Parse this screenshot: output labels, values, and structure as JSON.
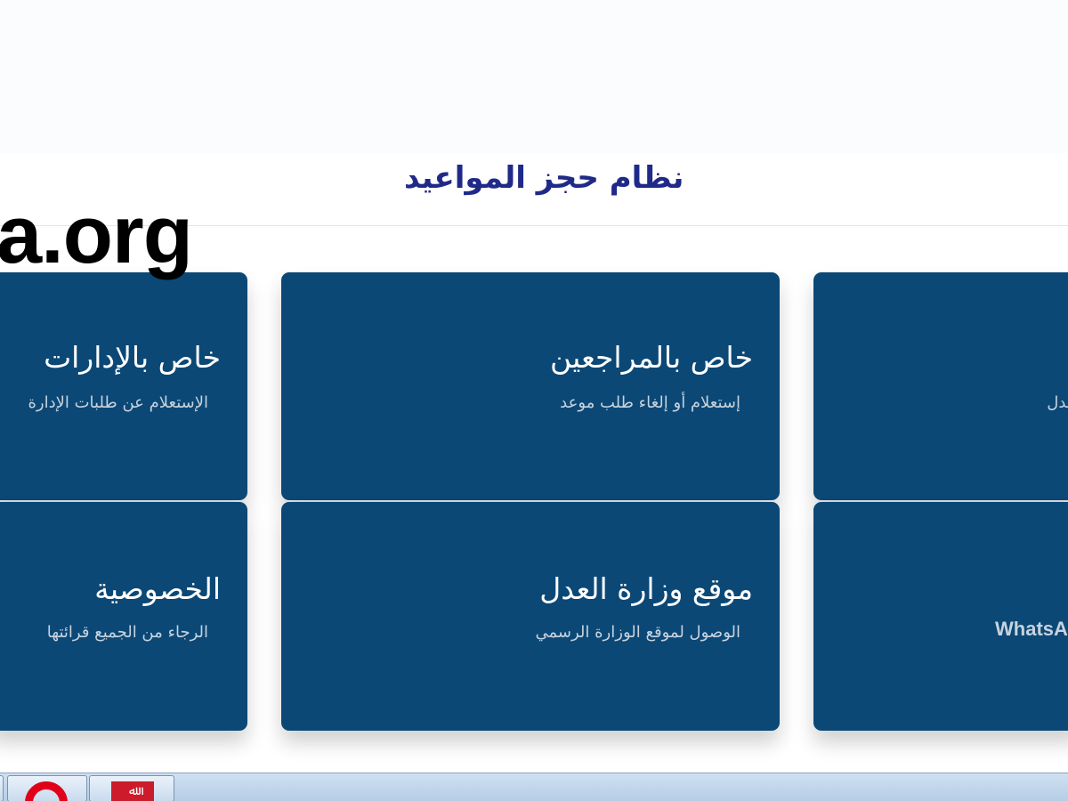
{
  "header": {
    "title": "نظام حجز المواعيد"
  },
  "watermark": "a.org",
  "cards": [
    {
      "title": "خاص بالإدارات",
      "subtitle": "الإستعلام عن طلبات الإدارة"
    },
    {
      "title": "خاص بالمراجعين",
      "subtitle": "إستعلام أو إلغاء طلب موعد"
    },
    {
      "title": "",
      "subtitle": "العدل"
    },
    {
      "title": "الخصوصية",
      "subtitle": "الرجاء من الجميع قرائتها"
    },
    {
      "title": "موقع وزارة العدل",
      "subtitle": "الوصول لموقع الوزارة الرسمي"
    },
    {
      "title": "",
      "subtitle": "WhatsA"
    }
  ],
  "taskbar": {
    "items": [
      "opera-browser",
      "app"
    ],
    "app_glyph": "ﷲ"
  },
  "colors": {
    "card_background": "#0b4876",
    "title_color": "#1f2a88",
    "card_subtitle": "#c7d3df"
  }
}
